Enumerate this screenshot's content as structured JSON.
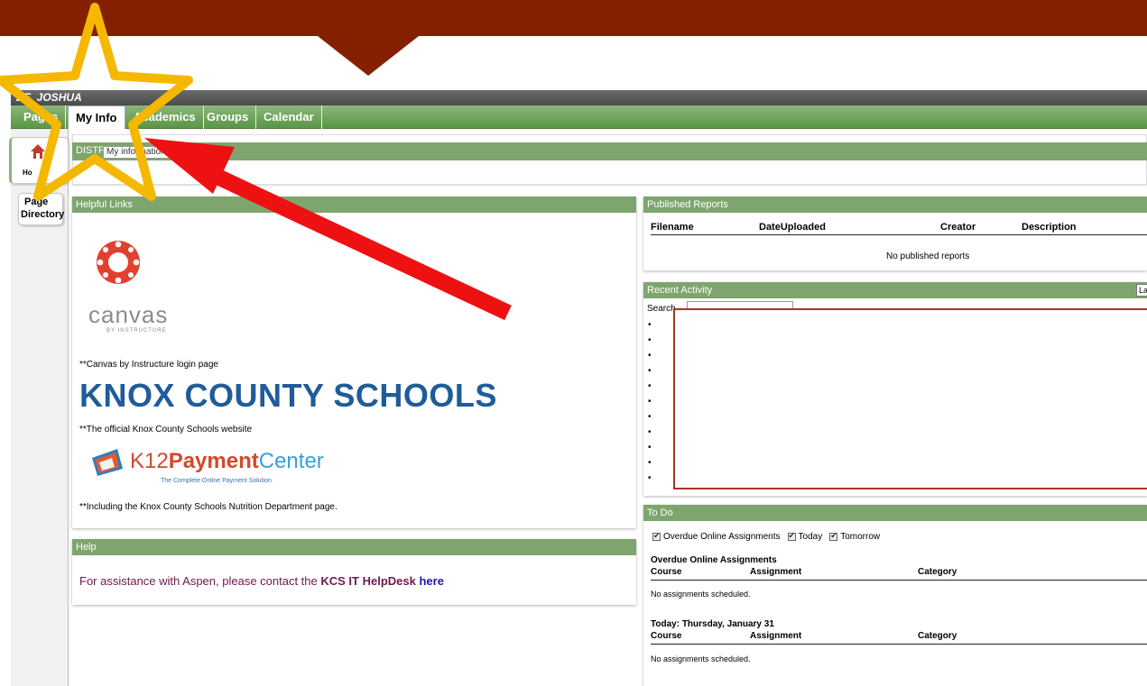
{
  "user": {
    "name": "EE, JOSHUA"
  },
  "tabs": [
    {
      "label": "Pages"
    },
    {
      "label": "My Info"
    },
    {
      "label": "Academics"
    },
    {
      "label": "Groups"
    },
    {
      "label": "Calendar"
    }
  ],
  "sidebar": {
    "home_label": "Ho",
    "directory_top": "Page",
    "directory_label": "Directory"
  },
  "district": {
    "label": "DISTR",
    "select_value": "My information"
  },
  "helpful_links": {
    "header": "Helpful Links",
    "canvas_word": "canvas",
    "canvas_sub": "BY INSTRUCTURE",
    "canvas_desc": "**Canvas by Instructure login page",
    "kcs_title": "KNOX COUNTY SCHOOLS",
    "kcs_desc": "**The official Knox County Schools website",
    "k12_name_a": "K12",
    "k12_name_b": "Payment",
    "k12_name_c": "Center",
    "k12_tag": "The Complete Online Payment Solution",
    "k12_desc": "**Including the Knox County Schools Nutrition Department page."
  },
  "help": {
    "header": "Help",
    "text": "For assistance with Aspen, please contact the ",
    "kcs": "KCS IT HelpDesk",
    "link": "here"
  },
  "published": {
    "header": "Published Reports",
    "columns": [
      "Filename",
      "DateUploaded",
      "Creator",
      "Description"
    ],
    "empty": "No published reports"
  },
  "recent": {
    "header": "Recent Activity",
    "search_label": "Search",
    "button_label": "La",
    "bullets": [
      "•",
      "•",
      "•",
      "•",
      "•",
      "•",
      "•",
      "•",
      "•",
      "•",
      "•"
    ]
  },
  "todo": {
    "header": "To Do",
    "checks": [
      "Overdue Online Assignments",
      "Today",
      "Tomorrow"
    ],
    "sections": [
      {
        "title": "Overdue Online Assignments",
        "columns": [
          "Course",
          "Assignment",
          "Category"
        ],
        "empty": "No assignments scheduled."
      },
      {
        "title": "Today: Thursday, January 31",
        "columns": [
          "Course",
          "Assignment",
          "Category"
        ],
        "empty": "No assignments scheduled."
      }
    ]
  },
  "colors": {
    "banner": "#842000",
    "tab_green": "#5b9646",
    "panel_header": "#7fa56e",
    "annotation_star": "#f5b800",
    "annotation_arrow": "#ee1111"
  },
  "annotations": {
    "star_icon": "star-outline-icon",
    "arrow_icon": "red-arrow-icon"
  }
}
